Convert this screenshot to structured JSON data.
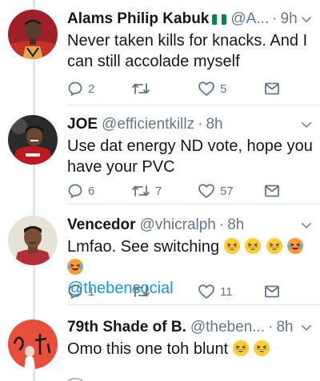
{
  "tweets": [
    {
      "name": "Alams Philip Kabuk",
      "handle": "@A...",
      "time": "9h",
      "text": "Never taken kills for knacks. And I can still accolade myself",
      "reply_count": "2",
      "retweet_count": "",
      "like_count": "5"
    },
    {
      "name": "JOE",
      "handle": "@efficientkillz",
      "time": "8h",
      "text": "Use dat energy ND vote, hope you have your PVC",
      "reply_count": "6",
      "retweet_count": "7",
      "like_count": "57"
    },
    {
      "name": "Vencedor",
      "handle": "@vhicralph",
      "time": "8h",
      "text": "Lmfao. See switching",
      "mention": "@thebensocial",
      "reply_count": "1",
      "retweet_count": "",
      "like_count": "11"
    },
    {
      "name": "79th Shade of B.",
      "handle": "@theben...",
      "time": "8h",
      "text": "Omo this one toh blunt"
    }
  ],
  "separator": "·",
  "colors": {
    "text": "#14171a",
    "muted": "#657786",
    "link": "#1b95e0",
    "divider": "#e1e8ed",
    "flag_green": "#008751"
  },
  "icons": [
    "reply-icon",
    "retweet-icon",
    "like-icon",
    "dm-icon",
    "chevron-down-icon",
    "nigeria-flag-icon",
    "grinning-squint-emoji",
    "crying-laughing-emoji"
  ]
}
